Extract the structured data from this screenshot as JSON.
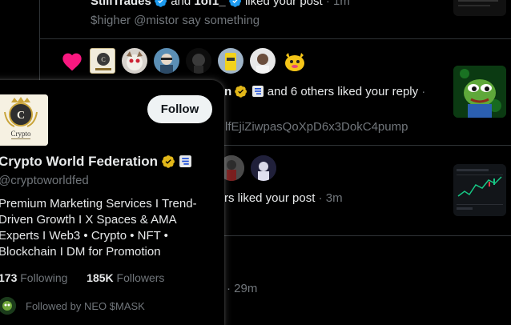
{
  "notification_top": {
    "actors": [
      "StillTrades",
      "1of1_"
    ],
    "joiner": "and",
    "action": "liked your post",
    "time": "1m",
    "post_text": "$higher @mistor say something"
  },
  "notification_like_reply": {
    "actor_fragment": "n",
    "action": "and 6 others liked your reply",
    "time_separator": "·",
    "sub_text": "lfEjiZiwpasQoXpD6x3DokC4pump"
  },
  "notification_like_post": {
    "action_fragment": "rs liked your post",
    "time": "3m"
  },
  "notification_bottom": {
    "time": "29m"
  },
  "hover_card": {
    "avatar_caption": "Crypto",
    "follow_label": "Follow",
    "name": "Crypto World Federation",
    "handle": "@cryptoworldfed",
    "bio_lines": [
      "Premium Marketing Services I Trend-",
      "Driven Growth I X Spaces & AMA",
      "Experts I Web3 • Crypto • NFT •",
      "Blockchain I DM for Promotion"
    ],
    "following_count": "173",
    "following_label": "Following",
    "followers_count": "185K",
    "followers_label": "Followers",
    "followed_by": "Followed by NEO $MASK"
  },
  "colors": {
    "background": "#000000",
    "text": "#e7e9ea",
    "muted": "#71767b",
    "verified_blue": "#1d9bf0",
    "verified_gold": "#e2b719",
    "heart": "#f91880"
  }
}
